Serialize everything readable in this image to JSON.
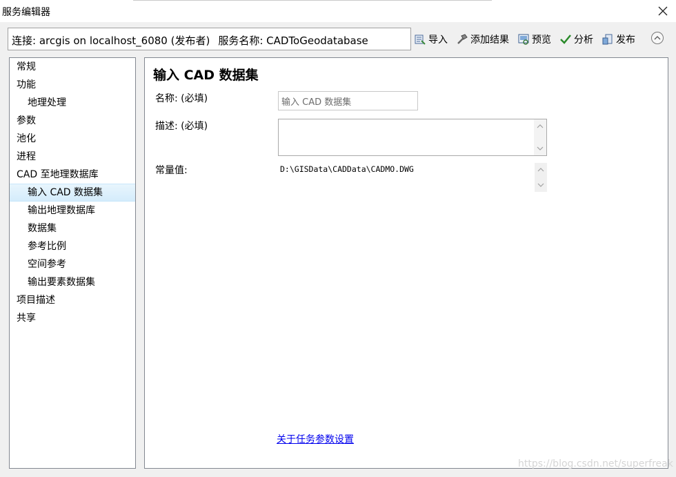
{
  "window": {
    "title": "服务编辑器"
  },
  "connection": {
    "label": "连接: arcgis on localhost_6080 (发布者)",
    "service_label": "服务名称: CADToGeodatabase"
  },
  "toolbar": {
    "import": "导入",
    "add_result": "添加结果",
    "preview": "预览",
    "analyze": "分析",
    "publish": "发布"
  },
  "sidebar": {
    "items": [
      {
        "label": "常规",
        "level": 0
      },
      {
        "label": "功能",
        "level": 0
      },
      {
        "label": "地理处理",
        "level": 1
      },
      {
        "label": "参数",
        "level": 0
      },
      {
        "label": "池化",
        "level": 0
      },
      {
        "label": "进程",
        "level": 0
      },
      {
        "label": "CAD 至地理数据库",
        "level": 0
      },
      {
        "label": "输入 CAD 数据集",
        "level": 1,
        "selected": true
      },
      {
        "label": "输出地理数据库",
        "level": 1
      },
      {
        "label": "数据集",
        "level": 1
      },
      {
        "label": "参考比例",
        "level": 1
      },
      {
        "label": "空间参考",
        "level": 1
      },
      {
        "label": "输出要素数据集",
        "level": 1
      },
      {
        "label": "项目描述",
        "level": 0
      },
      {
        "label": "共享",
        "level": 0
      }
    ]
  },
  "panel": {
    "title": "输入 CAD 数据集",
    "name_label": "名称: (必填)",
    "name_value": "输入 CAD 数据集",
    "desc_label": "描述: (必填)",
    "desc_value": "",
    "const_label": "常量值:",
    "const_value": "D:\\GISData\\CADData\\CADMO.DWG",
    "help_link": "关于任务参数设置"
  },
  "watermark": "https://blog.csdn.net/superfreak"
}
